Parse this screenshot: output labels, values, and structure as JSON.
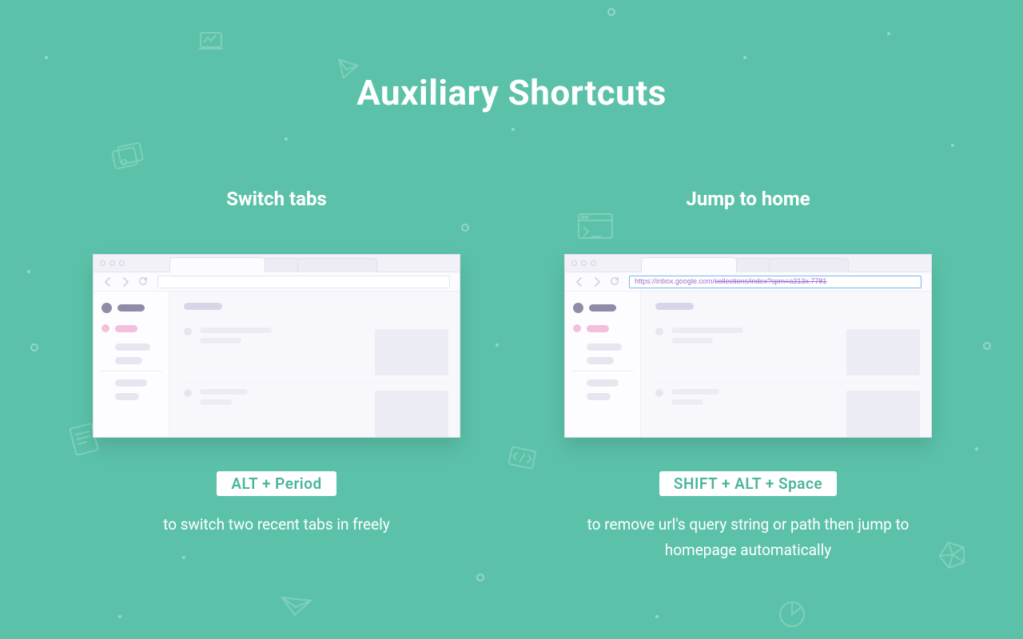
{
  "page": {
    "title": "Auxiliary Shortcuts"
  },
  "left": {
    "title": "Switch tabs",
    "shortcut": "ALT + Period",
    "desc": "to switch two recent tabs in freely"
  },
  "right": {
    "title": "Jump to home",
    "shortcut": "SHIFT + ALT + Space",
    "desc": "to remove url's query string or path then jump to homepage automatically",
    "url_keep": "https://inbox.google.com/",
    "url_strike": "collections/index?spm=a313x.7781"
  }
}
